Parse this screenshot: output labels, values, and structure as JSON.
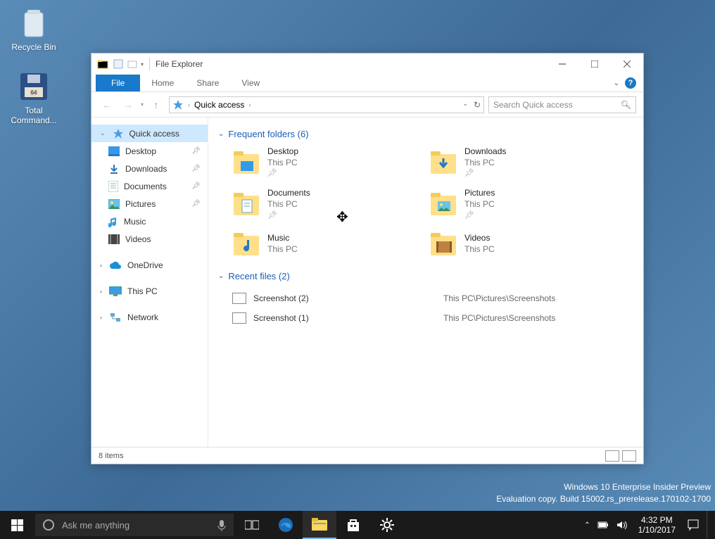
{
  "desktop": {
    "icons": [
      {
        "name": "Recycle Bin"
      },
      {
        "name": "Total Command..."
      }
    ],
    "watermark_line1": "Windows 10 Enterprise Insider Preview",
    "watermark_line2": "Evaluation copy. Build 15002.rs_prerelease.170102-1700"
  },
  "window": {
    "title": "File Explorer",
    "tabs": {
      "file": "File",
      "home": "Home",
      "share": "Share",
      "view": "View"
    },
    "breadcrumb": {
      "root": "Quick access"
    },
    "search_placeholder": "Search Quick access",
    "nav": {
      "quick_access": "Quick access",
      "items": [
        {
          "label": "Desktop",
          "pinned": true
        },
        {
          "label": "Downloads",
          "pinned": true
        },
        {
          "label": "Documents",
          "pinned": true
        },
        {
          "label": "Pictures",
          "pinned": true
        },
        {
          "label": "Music",
          "pinned": false
        },
        {
          "label": "Videos",
          "pinned": false
        }
      ],
      "onedrive": "OneDrive",
      "this_pc": "This PC",
      "network": "Network"
    },
    "groups": {
      "frequent": {
        "label": "Frequent folders (6)",
        "items": [
          {
            "name": "Desktop",
            "loc": "This PC"
          },
          {
            "name": "Downloads",
            "loc": "This PC"
          },
          {
            "name": "Documents",
            "loc": "This PC"
          },
          {
            "name": "Pictures",
            "loc": "This PC"
          },
          {
            "name": "Music",
            "loc": "This PC"
          },
          {
            "name": "Videos",
            "loc": "This PC"
          }
        ]
      },
      "recent": {
        "label": "Recent files (2)",
        "items": [
          {
            "name": "Screenshot (2)",
            "path": "This PC\\Pictures\\Screenshots"
          },
          {
            "name": "Screenshot (1)",
            "path": "This PC\\Pictures\\Screenshots"
          }
        ]
      }
    },
    "status": "8 items"
  },
  "taskbar": {
    "search_placeholder": "Ask me anything",
    "time": "4:32 PM",
    "date": "1/10/2017"
  }
}
